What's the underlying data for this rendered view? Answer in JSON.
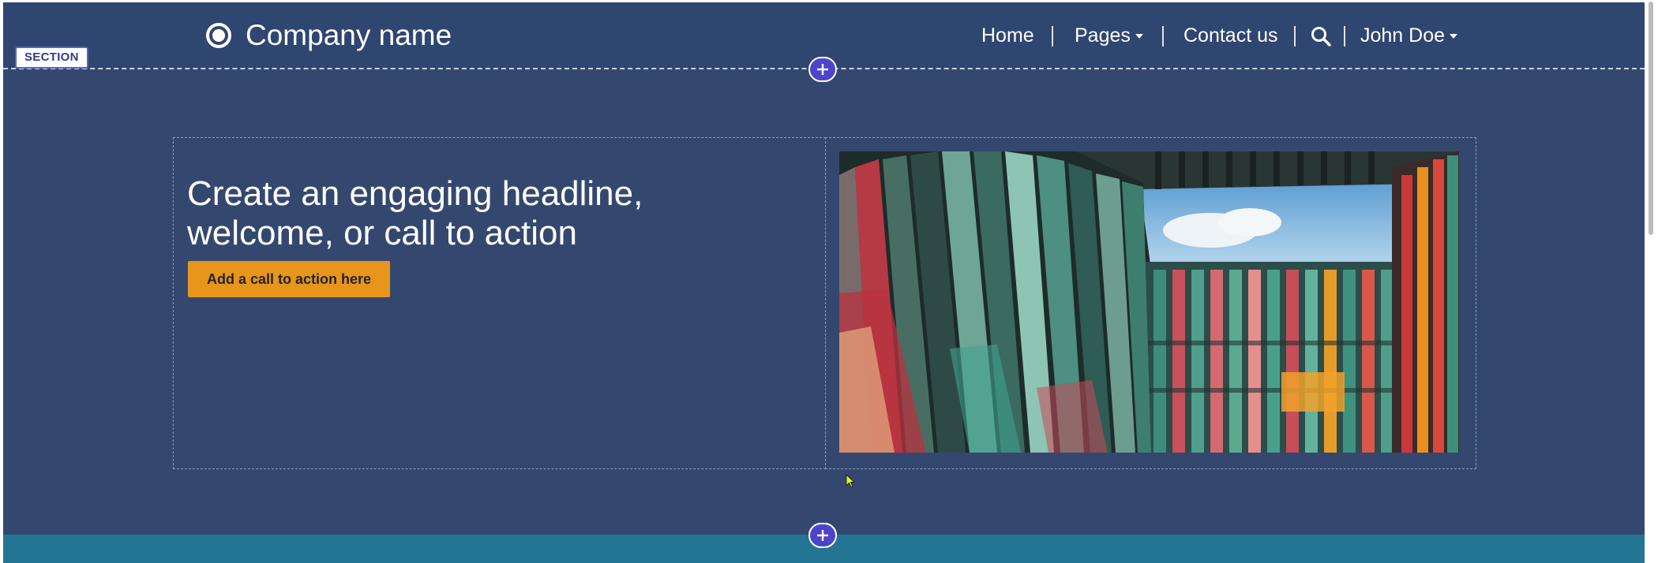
{
  "section_badge": "SECTION",
  "header": {
    "company_name": "Company name",
    "nav": {
      "home": "Home",
      "pages": "Pages",
      "contact": "Contact us",
      "user": "John Doe"
    }
  },
  "hero": {
    "headline": "Create an engaging headline, welcome, or call to action",
    "cta_label": "Add a call to action here"
  },
  "icons": {
    "logo": "logo-icon",
    "search": "search-icon",
    "add_section": "plus-icon",
    "cursor": "cursor-icon"
  },
  "colors": {
    "header_bg": "#2f4670",
    "section_bg": "#34486f",
    "cta_bg": "#e7961b",
    "add_button_bg": "#4d45c8",
    "bottom_band": "#247494"
  }
}
